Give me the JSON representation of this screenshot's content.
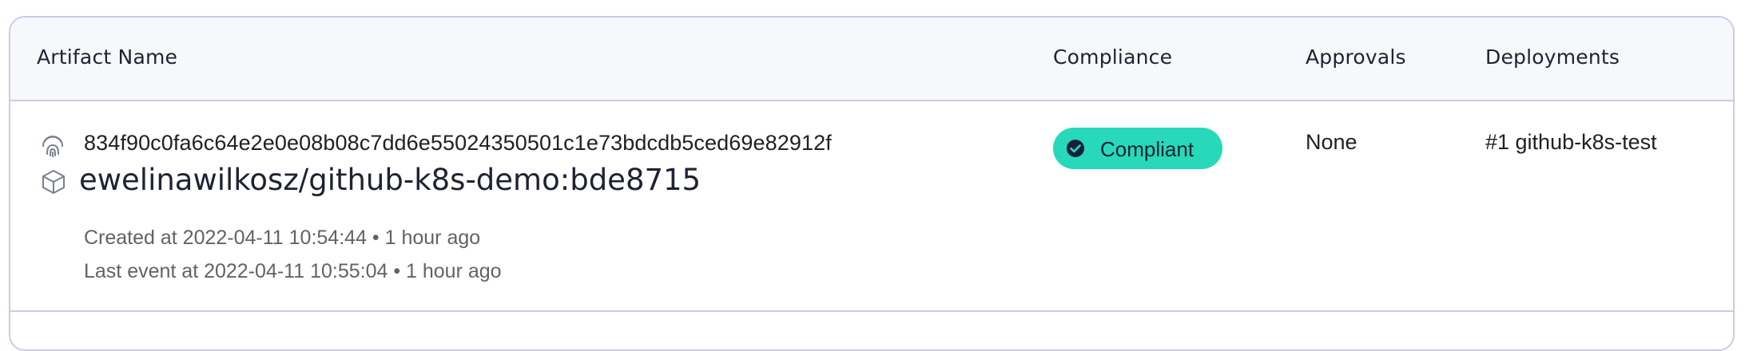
{
  "table": {
    "columns": {
      "artifact_name": "Artifact Name",
      "compliance": "Compliance",
      "approvals": "Approvals",
      "deployments": "Deployments"
    },
    "rows": [
      {
        "sha": "834f90c0fa6c64e2e0e08b08c7dd6e55024350501c1e73bdcdb5ced69e82912f",
        "name": "ewelinawilkosz/github-k8s-demo:bde8715",
        "created": "Created at 2022-04-11 10:54:44 • 1 hour ago",
        "last_event": "Last event at 2022-04-11 10:55:04 • 1 hour ago",
        "compliance": "Compliant",
        "approvals": "None",
        "deployments": "#1 github-k8s-test"
      }
    ]
  },
  "colors": {
    "compliant_badge": "#27d9b8",
    "border": "#c9cde0",
    "header_bg": "#f7f8fc"
  },
  "icons": {
    "sha": "fingerprint-icon",
    "artifact": "cube-icon",
    "compliance": "check-circle-icon"
  }
}
